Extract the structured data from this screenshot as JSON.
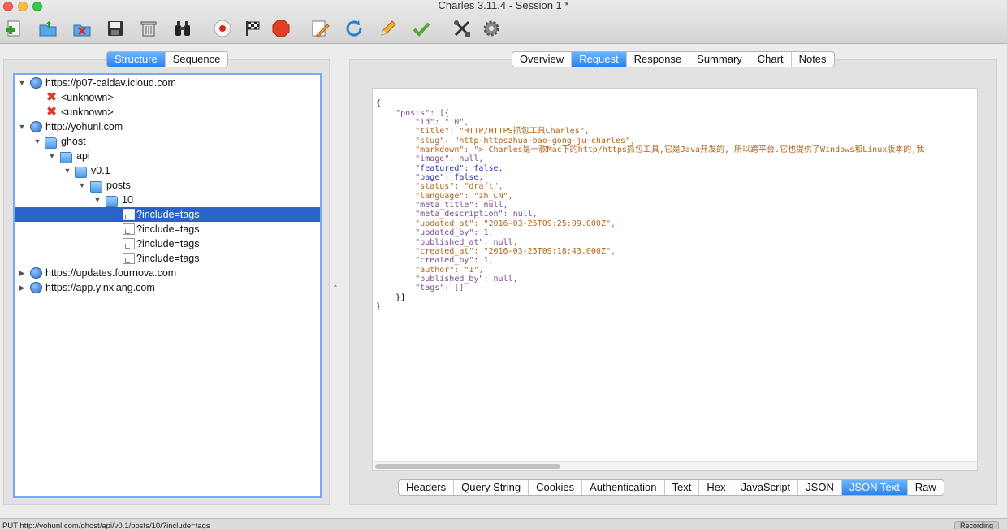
{
  "window": {
    "title": "Charles 3.11.4 - Session 1 *"
  },
  "toolbar": {
    "buttons": [
      {
        "name": "new-session",
        "icon": "add-document-icon"
      },
      {
        "name": "open-session",
        "icon": "folder-open-icon"
      },
      {
        "name": "close-session",
        "icon": "close-document-icon"
      },
      {
        "name": "save-session",
        "icon": "floppy-disk-icon"
      },
      {
        "name": "clear-session",
        "icon": "trash-icon"
      },
      {
        "name": "find",
        "icon": "binoculars-icon"
      },
      {
        "name": "record",
        "icon": "record-icon"
      },
      {
        "name": "throttle",
        "icon": "checkered-flag-icon"
      },
      {
        "name": "breakpoints",
        "icon": "stop-sign-icon"
      },
      {
        "name": "compose",
        "icon": "edit-request-icon"
      },
      {
        "name": "repeat",
        "icon": "refresh-icon"
      },
      {
        "name": "edit",
        "icon": "pencil-icon"
      },
      {
        "name": "validate",
        "icon": "checkmark-icon"
      },
      {
        "name": "tools",
        "icon": "tools-icon"
      },
      {
        "name": "settings",
        "icon": "gear-icon"
      }
    ]
  },
  "left": {
    "view_tabs": [
      "Structure",
      "Sequence"
    ],
    "active_view": "Structure",
    "tree": [
      {
        "label": "https://p07-caldav.icloud.com",
        "type": "host",
        "level": 0,
        "expanded": true
      },
      {
        "label": "<unknown>",
        "type": "error",
        "level": 1
      },
      {
        "label": "<unknown>",
        "type": "error",
        "level": 1
      },
      {
        "label": "http://yohunl.com",
        "type": "host",
        "level": 0,
        "expanded": true
      },
      {
        "label": "ghost",
        "type": "folder",
        "level": 1,
        "expanded": true
      },
      {
        "label": "api",
        "type": "folder",
        "level": 2,
        "expanded": true
      },
      {
        "label": "v0.1",
        "type": "folder",
        "level": 3,
        "expanded": true
      },
      {
        "label": "posts",
        "type": "folder",
        "level": 4,
        "expanded": true
      },
      {
        "label": "10",
        "type": "folder",
        "level": 5,
        "expanded": true
      },
      {
        "label": "?include=tags",
        "type": "request",
        "level": 6,
        "selected": true
      },
      {
        "label": "?include=tags",
        "type": "request",
        "level": 6
      },
      {
        "label": "?include=tags",
        "type": "request",
        "level": 6
      },
      {
        "label": "?include=tags",
        "type": "request",
        "level": 6
      },
      {
        "label": "https://updates.fournova.com",
        "type": "host",
        "level": 0,
        "expanded": false
      },
      {
        "label": "https://app.yinxiang.com",
        "type": "host",
        "level": 0,
        "expanded": false
      }
    ]
  },
  "right": {
    "top_tabs": [
      "Overview",
      "Request",
      "Response",
      "Summary",
      "Chart",
      "Notes"
    ],
    "active_top_tab": "Request",
    "bottom_tabs": [
      "Headers",
      "Query String",
      "Cookies",
      "Authentication",
      "Text",
      "Hex",
      "JavaScript",
      "JSON",
      "JSON Text",
      "Raw"
    ],
    "active_bottom_tab": "JSON Text",
    "json_lines": [
      "{",
      "    \"posts\": [{",
      "        \"id\": \"10\",",
      "        \"title\": \"HTTP/HTTPS抓包工具Charles\",",
      "        \"slug\": \"http-httpszhua-bao-gong-ju-charles\",",
      "        \"markdown\": \"> Charles是一款Mac下的http/https抓包工具,它是Java开发的, 所以跨平台.它也提供了Windows和Linux版本的,我",
      "        \"image\": null,",
      "        \"featured\": false,",
      "        \"page\": false,",
      "        \"status\": \"draft\",",
      "        \"language\": \"zh_CN\",",
      "        \"meta_title\": null,",
      "        \"meta_description\": null,",
      "        \"updated_at\": \"2016-03-25T09:25:09.000Z\",",
      "        \"updated_by\": 1,",
      "        \"published_at\": null,",
      "        \"created_at\": \"2016-03-25T09:18:43.000Z\",",
      "        \"created_by\": 1,",
      "        \"author\": \"1\",",
      "        \"published_by\": null,",
      "        \"tags\": []",
      "    }]",
      "}"
    ]
  },
  "status": {
    "text": "PUT http://yohunl.com/ghost/api/v0.1/posts/10/?include=tags",
    "recording": "Recording"
  }
}
